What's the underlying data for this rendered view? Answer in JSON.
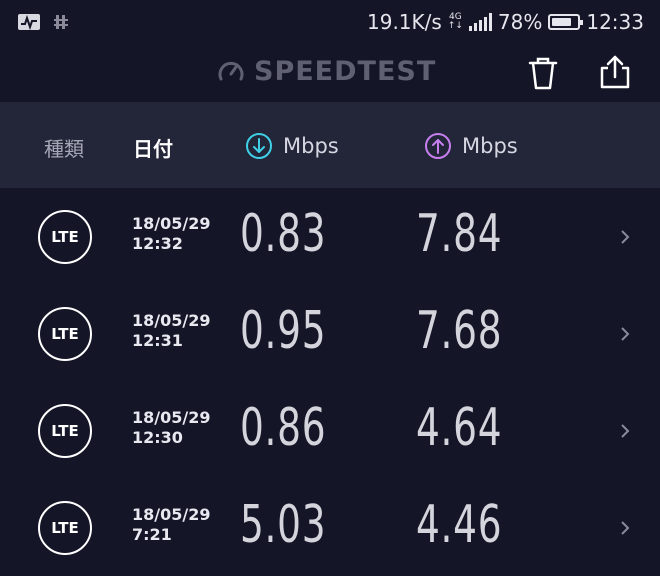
{
  "status_bar": {
    "net_speed": "19.1K/s",
    "net_type_top": "4G",
    "battery_text": "78%",
    "battery_level": 0.78,
    "time": "12:33"
  },
  "app_bar": {
    "logo_text": "SPEEDTEST",
    "icons": [
      "speedometer-icon",
      "trash-icon",
      "share-icon"
    ]
  },
  "header": {
    "type_label": "種類",
    "date_label": "日付",
    "download_label": "Mbps",
    "upload_label": "Mbps",
    "download_color": "#3fd0e8",
    "upload_color": "#c77ff0"
  },
  "results": [
    {
      "type": "LTE",
      "date": "18/05/29",
      "time": "12:32",
      "download": "0.83",
      "upload": "7.84"
    },
    {
      "type": "LTE",
      "date": "18/05/29",
      "time": "12:31",
      "download": "0.95",
      "upload": "7.68"
    },
    {
      "type": "LTE",
      "date": "18/05/29",
      "time": "12:30",
      "download": "0.86",
      "upload": "4.64"
    },
    {
      "type": "LTE",
      "date": "18/05/29",
      "time": "7:21",
      "download": "5.03",
      "upload": "4.46"
    }
  ]
}
